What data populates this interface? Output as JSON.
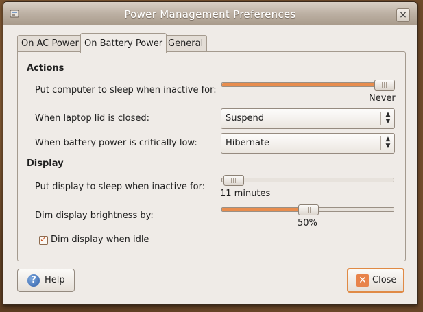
{
  "window": {
    "title": "Power Management Preferences"
  },
  "tabs": [
    {
      "label": "On AC Power"
    },
    {
      "label": "On Battery Power",
      "active": true
    },
    {
      "label": "General"
    }
  ],
  "actions": {
    "heading": "Actions",
    "sleep_label": "Put computer to sleep when inactive for:",
    "sleep_value": "Never",
    "sleep_level": 1.0,
    "lid_label": "When laptop lid is closed:",
    "lid_value": "Suspend",
    "battery_label": "When battery power is critically low:",
    "battery_value": "Hibernate"
  },
  "display": {
    "heading": "Display",
    "sleep_label": "Put display to sleep when inactive for:",
    "sleep_value": "11 minutes",
    "sleep_level": 0.0,
    "dim_label": "Dim display brightness by:",
    "dim_value": "50%",
    "dim_level": 0.5,
    "dim_idle_label": "Dim display when idle",
    "dim_idle_checked": true
  },
  "buttons": {
    "help": "Help",
    "close": "Close"
  },
  "colors": {
    "accent": "#e88d4e",
    "titlebar_text": "#ffffff"
  },
  "icons": {
    "title": "power-icon",
    "help": "help-icon",
    "close": "close-icon"
  }
}
